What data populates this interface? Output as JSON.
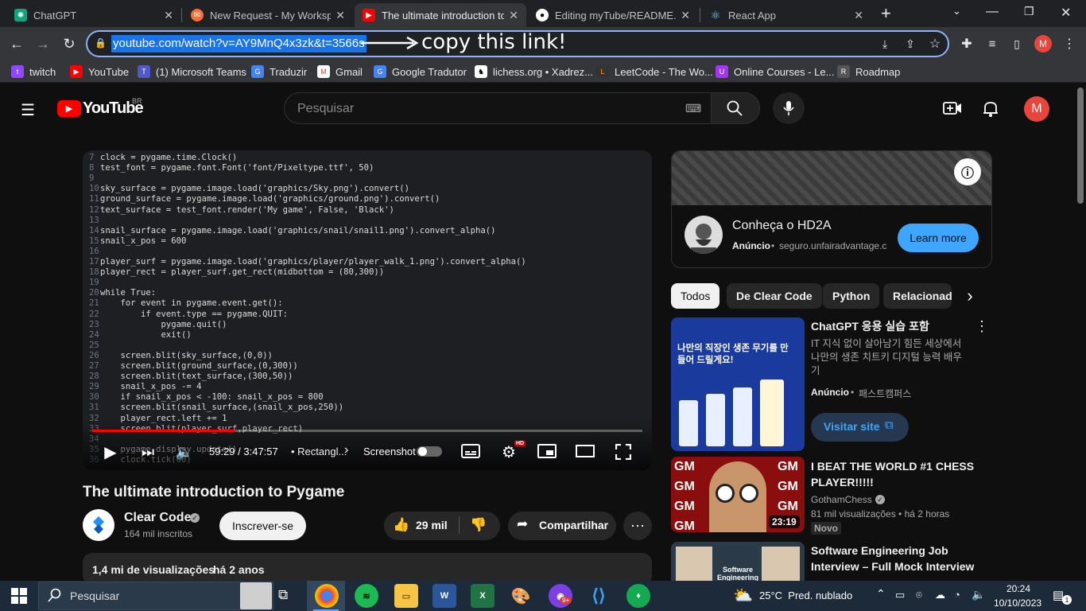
{
  "browser": {
    "tabs": [
      {
        "title": "ChatGPT",
        "icon": "chatgpt-icon",
        "color": "#10a37f"
      },
      {
        "title": "New Request - My Workspac",
        "icon": "postman-icon",
        "color": "#ff6c37"
      },
      {
        "title": "The ultimate introduction to",
        "icon": "youtube-icon",
        "color": "#ff0000"
      },
      {
        "title": "Editing myTube/README.m",
        "icon": "github-icon",
        "color": "#ffffff"
      },
      {
        "title": "React App",
        "icon": "react-icon",
        "color": "#61dafb"
      }
    ],
    "new_tab": "+",
    "url": "youtube.com/watch?v=AY9MnQ4x3zk&t=3566s",
    "annotation": "copy this link!",
    "profile_initial": "M",
    "bookmarks": [
      {
        "label": "twitch",
        "icon": "twitch-icon",
        "color": "#9146ff"
      },
      {
        "label": "YouTube",
        "icon": "youtube-icon",
        "color": "#ff0000"
      },
      {
        "label": "(1) Microsoft Teams",
        "icon": "teams-icon",
        "color": "#5059c9"
      },
      {
        "label": "Traduzir",
        "icon": "translate-icon",
        "color": "#4285f4"
      },
      {
        "label": "Gmail",
        "icon": "gmail-icon",
        "color": "#ea4335"
      },
      {
        "label": "Google Tradutor",
        "icon": "google-translate-icon",
        "color": "#4285f4"
      },
      {
        "label": "lichess.org • Xadrez...",
        "icon": "lichess-icon",
        "color": "#ffffff"
      },
      {
        "label": "LeetCode - The Wo...",
        "icon": "leetcode-icon",
        "color": "#ffa116"
      },
      {
        "label": "Online Courses - Le...",
        "icon": "udemy-icon",
        "color": "#a435f0"
      },
      {
        "label": "Roadmap",
        "icon": "roadmap-icon",
        "color": "#cccccc"
      }
    ]
  },
  "youtube": {
    "logo": "YouTube",
    "region": "BR",
    "search_placeholder": "Pesquisar",
    "avatar_initial": "M",
    "video": {
      "title": "The ultimate introduction to Pygame",
      "time": "59:29 / 3:47:57",
      "chapter": "• Rectangl...",
      "screenshot_label": "Screenshot",
      "hd_badge": "HD",
      "progress_fraction": 0.26,
      "code_lines": [
        {
          "n": "7",
          "t": "clock = pygame.time.Clock()"
        },
        {
          "n": "8",
          "t": "test_font = pygame.font.Font('font/Pixeltype.ttf', 50)"
        },
        {
          "n": "9",
          "t": ""
        },
        {
          "n": "10",
          "t": "sky_surface = pygame.image.load('graphics/Sky.png').convert()"
        },
        {
          "n": "11",
          "t": "ground_surface = pygame.image.load('graphics/ground.png').convert()"
        },
        {
          "n": "12",
          "t": "text_surface = test_font.render('My game', False, 'Black')"
        },
        {
          "n": "13",
          "t": ""
        },
        {
          "n": "14",
          "t": "snail_surface = pygame.image.load('graphics/snail/snail1.png').convert_alpha()"
        },
        {
          "n": "15",
          "t": "snail_x_pos = 600"
        },
        {
          "n": "16",
          "t": ""
        },
        {
          "n": "17",
          "t": "player_surf = pygame.image.load('graphics/player/player_walk_1.png').convert_alpha()"
        },
        {
          "n": "18",
          "t": "player_rect = player_surf.get_rect(midbottom = (80,300))"
        },
        {
          "n": "19",
          "t": ""
        },
        {
          "n": "20",
          "t": "while True:"
        },
        {
          "n": "21",
          "t": "    for event in pygame.event.get():"
        },
        {
          "n": "22",
          "t": "        if event.type == pygame.QUIT:"
        },
        {
          "n": "23",
          "t": "            pygame.quit()"
        },
        {
          "n": "24",
          "t": "            exit()"
        },
        {
          "n": "25",
          "t": ""
        },
        {
          "n": "26",
          "t": "    screen.blit(sky_surface,(0,0))"
        },
        {
          "n": "27",
          "t": "    screen.blit(ground_surface,(0,300))"
        },
        {
          "n": "28",
          "t": "    screen.blit(text_surface,(300,50))"
        },
        {
          "n": "29",
          "t": "    snail_x_pos -= 4"
        },
        {
          "n": "30",
          "t": "    if snail_x_pos < -100: snail_x_pos = 800"
        },
        {
          "n": "31",
          "t": "    screen.blit(snail_surface,(snail_x_pos,250))"
        },
        {
          "n": "32",
          "t": "    player_rect.left += 1"
        },
        {
          "n": "33",
          "t": "    screen.blit(player_surf,player_rect)"
        },
        {
          "n": "34",
          "t": ""
        },
        {
          "n": "35",
          "t": "    pygame.display.update()"
        },
        {
          "n": "36",
          "t": "    clock.tick(60)"
        }
      ]
    },
    "channel": {
      "name": "Clear Code",
      "subs": "164 mil inscritos",
      "subscribe": "Inscrever-se",
      "likes": "29 mil",
      "share": "Compartilhar"
    },
    "description": {
      "views": "1,4 mi de visualizações",
      "age": "há 2 anos"
    },
    "ad": {
      "title": "Conheça o HD2A",
      "label": "Anúncio",
      "domain": "seguro.unfairadvantage.c",
      "cta": "Learn more"
    },
    "chips": [
      "Todos",
      "De Clear Code",
      "Python",
      "Relacionados"
    ],
    "recommended": [
      {
        "title": "ChatGPT 응용 실습 포함",
        "desc": "IT 지식 없이 살아남기 힘든 세상에서 나만의 생존 치트키 디지털 능력 배우기",
        "channel": "Anúncio",
        "sponsor": "패스트캠퍼스",
        "cta": "Visitar site",
        "thumb_text": "나만의 직장인 생존 무기를 만들어 드릴게요!"
      },
      {
        "title": "I BEAT THE WORLD #1 CHESS PLAYER!!!!!",
        "channel": "GothamChess",
        "meta": "81 mil visualizações • há 2 horas",
        "badge": "Novo",
        "duration": "23:19",
        "thumb_text": "GM"
      },
      {
        "title": "Software Engineering Job Interview – Full Mock Interview",
        "thumb_text": "Software Engineering"
      }
    ]
  },
  "taskbar": {
    "search": "Pesquisar",
    "weather": "25°C  Pred. nublado",
    "time": "20:24",
    "date": "10/10/2023",
    "notifications": "1"
  }
}
